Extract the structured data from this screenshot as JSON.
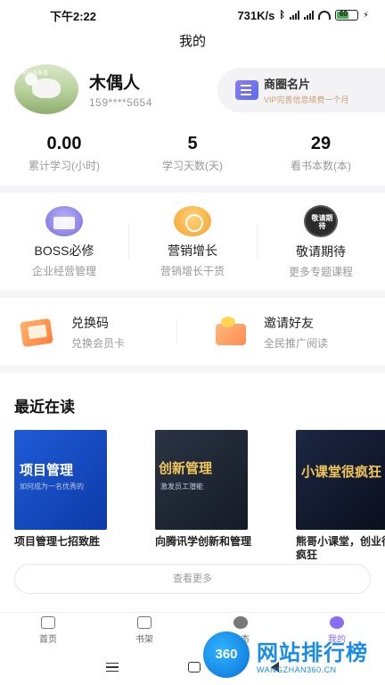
{
  "status": {
    "time": "下午2:22",
    "speed": "731K/s",
    "battery": "60"
  },
  "header": {
    "title": "我的"
  },
  "profile": {
    "name": "木偶人",
    "phone": "159****5654",
    "avatar_caption": "市玩去养昌"
  },
  "card": {
    "title": "商圈名片",
    "subtitle": "VIP完善信息续费一个月"
  },
  "stats": [
    {
      "value": "0.00",
      "label": "累计学习(小时)"
    },
    {
      "value": "5",
      "label": "学习天数(天)"
    },
    {
      "value": "29",
      "label": "看书本数(本)"
    }
  ],
  "tools": [
    {
      "title": "BOSS必修",
      "sub": "企业经营管理",
      "icon": "book-stack-icon"
    },
    {
      "title": "营销增长",
      "sub": "营销增长干货",
      "icon": "marketing-icon"
    },
    {
      "title": "敬请期待",
      "sub": "更多专题课程",
      "icon": "coming-soon-icon",
      "badge": "敬请期待"
    }
  ],
  "actions": [
    {
      "title": "兑换码",
      "sub": "兑换会员卡",
      "icon": "redeem-code-icon"
    },
    {
      "title": "邀请好友",
      "sub": "全民推广阅读",
      "icon": "invite-friends-icon"
    }
  ],
  "recent": {
    "title": "最近在读",
    "books": [
      {
        "cover_big": "项目管理",
        "cover_small": "如何成为一名优秀的",
        "title": "项目管理七招致胜"
      },
      {
        "cover_big": "创新管理",
        "cover_small": "激发员工潜能",
        "title": "向腾讯学创新和管理"
      },
      {
        "cover_big": "小课堂很疯狂",
        "cover_small": "",
        "title": "熊哥小课堂，创业很疯狂"
      }
    ],
    "more_label": "查看更多"
  },
  "tabbar": [
    {
      "label": "首页",
      "icon": "home-icon"
    },
    {
      "label": "书架",
      "icon": "bookshelf-icon"
    },
    {
      "label": "动态",
      "icon": "compass-icon"
    },
    {
      "label": "我的",
      "icon": "profile-icon"
    }
  ],
  "watermark": {
    "logo": "360",
    "name": "网站排行榜",
    "url": "WANGZHAN360.CN"
  },
  "colors": {
    "accent": "#8a6cf0",
    "watermark": "#1b8be8",
    "gold": "#c8a274"
  }
}
